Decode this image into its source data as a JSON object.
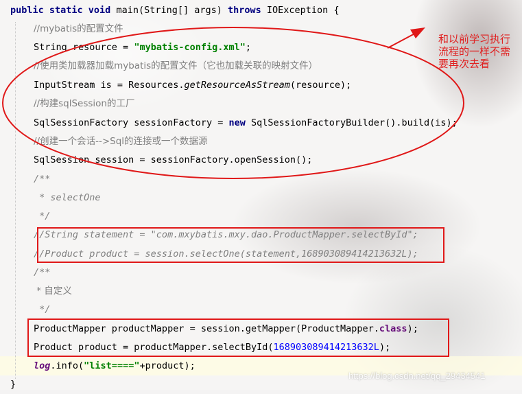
{
  "code": {
    "line1": {
      "kw1": "public static void",
      "text1": " main(String[] args) ",
      "kw2": "throws",
      "text2": " IOException {"
    },
    "line2": {
      "comment": "//mybatis的配置文件"
    },
    "line3": {
      "text1": "String resource = ",
      "str": "\"mybatis-config.xml\"",
      "text2": ";"
    },
    "line4": {
      "comment": "//使用类加载器加载mybatis的配置文件（它也加载关联的映射文件）"
    },
    "line5": {
      "text1": "InputStream is = Resources.",
      "call": "getResourceAsStream",
      "text2": "(resource);"
    },
    "line6": {
      "comment": "//构建sqlSession的工厂"
    },
    "line7": {
      "text1": "SqlSessionFactory sessionFactory = ",
      "kw": "new",
      "text2": " SqlSessionFactoryBuilder().build(is);"
    },
    "line8": {
      "comment": "//创建一个会话-->Sql的连接或一个数据源"
    },
    "line9": {
      "text": "SqlSession session = sessionFactory.openSession();"
    },
    "line10": {
      "text": "/**"
    },
    "line11": {
      "text": " * selectOne"
    },
    "line12": {
      "text": " */"
    },
    "line13": {
      "text": "//String statement = \"com.mxybatis.mxy.dao.ProductMapper.selectById\";"
    },
    "line14": {
      "text": "//Product product = session.selectOne(statement,168903089414213632L);"
    },
    "line15": {
      "text": "/**"
    },
    "line16": {
      "text": " * 自定义"
    },
    "line17": {
      "text": " */"
    },
    "line18": {
      "text1": "ProductMapper productMapper = session.getMapper(ProductMapper.",
      "kw": "class",
      "text2": ");"
    },
    "line19": {
      "text1": "Product product = productMapper.selectById(",
      "num": "168903089414213632L",
      "text2": ");"
    },
    "line20": {
      "field": "log",
      "text1": ".info(",
      "str": "\"list====\"",
      "text2": "+product);"
    },
    "line21": {
      "text": "}"
    }
  },
  "annotation": {
    "text": "和以前学习执行流程的一样不需要再次去看",
    "color": "#e02020"
  },
  "watermark": "https://blog.csdn.net/qq_29434541"
}
